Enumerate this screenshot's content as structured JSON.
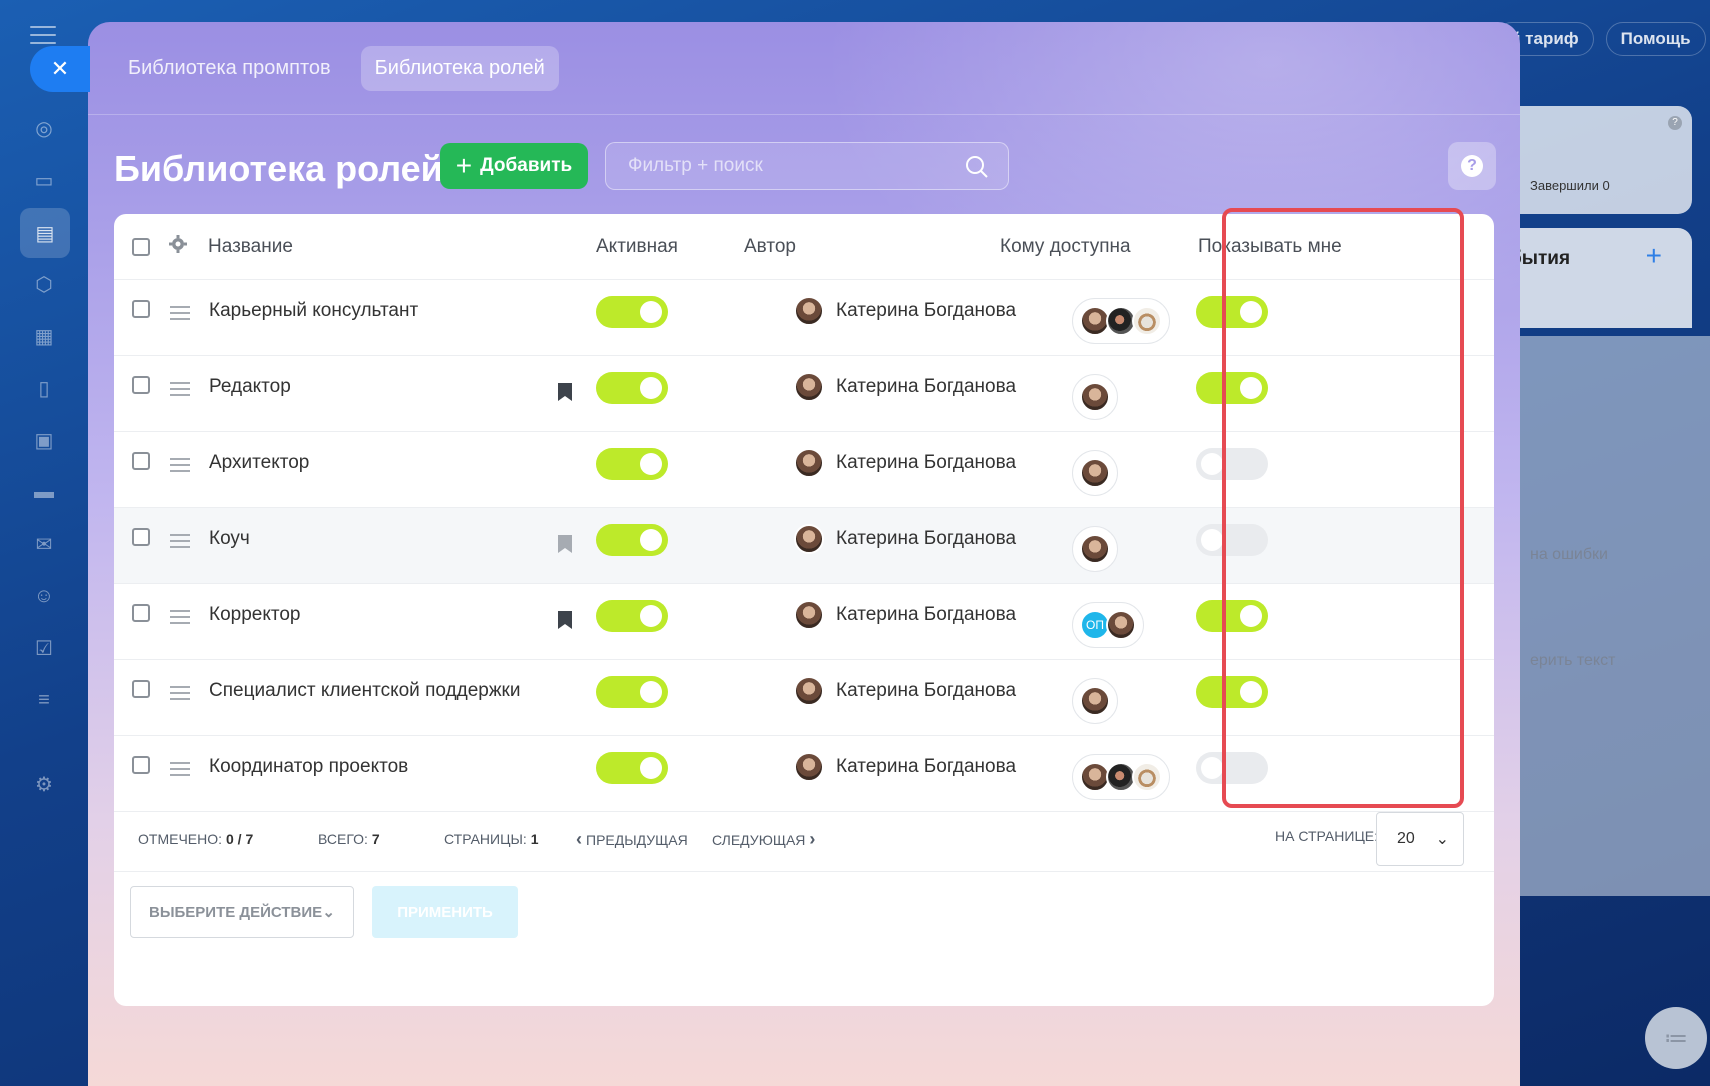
{
  "background": {
    "top_right": [
      "й тариф",
      "Помощь"
    ],
    "card_done": "Завершили 0",
    "card2_title": "бытия",
    "panel_line1": "на ошибки",
    "panel_line2": "ерить текст"
  },
  "tabs": [
    {
      "label": "Библиотека промптов",
      "active": false
    },
    {
      "label": "Библиотека ролей",
      "active": true
    }
  ],
  "page_title": "Библиотека ролей",
  "add_button": "Добавить",
  "search": {
    "placeholder": "Фильтр + поиск"
  },
  "help": "?",
  "columns": {
    "name": "Название",
    "active": "Активная",
    "author": "Автор",
    "access": "Кому доступна",
    "show_me": "Показывать мне"
  },
  "rows": [
    {
      "name": "Карьерный консультант",
      "bookmark": "none",
      "active": true,
      "author": "Катерина Богданова",
      "access": [
        "user",
        "user-dark",
        "cups"
      ],
      "show_me": true
    },
    {
      "name": "Редактор",
      "bookmark": "dark",
      "active": true,
      "author": "Катерина Богданова",
      "access": [
        "user"
      ],
      "show_me": true
    },
    {
      "name": "Архитектор",
      "bookmark": "none",
      "active": true,
      "author": "Катерина Богданова",
      "access": [
        "user"
      ],
      "show_me": false
    },
    {
      "name": "Коуч",
      "bookmark": "light",
      "active": true,
      "author": "Катерина Богданова",
      "access": [
        "user"
      ],
      "show_me": false
    },
    {
      "name": "Корректор",
      "bookmark": "dark",
      "active": true,
      "author": "Катерина Богданова",
      "access": [
        "ОП",
        "user"
      ],
      "show_me": true
    },
    {
      "name": "Специалист клиентской поддержки",
      "bookmark": "none",
      "active": true,
      "author": "Катерина Богданова",
      "access": [
        "user"
      ],
      "show_me": true
    },
    {
      "name": "Координатор проектов",
      "bookmark": "none",
      "active": true,
      "author": "Катерина Богданова",
      "access": [
        "user",
        "user-dark",
        "cups"
      ],
      "show_me": false
    }
  ],
  "footer": {
    "selected_label": "Отмечено:",
    "selected_value": "0 / 7",
    "total_label": "Всего:",
    "total_value": "7",
    "pages_label": "Страницы:",
    "pages_value": "1",
    "prev": "Предыдущая",
    "next": "Следующая",
    "per_page_label": "На странице:",
    "per_page_value": "20",
    "action_placeholder": "Выберите действие",
    "apply": "Применить"
  },
  "colors": {
    "toggle_on": "#bdea2a",
    "add_button": "#25b857",
    "highlight": "#e64a52"
  }
}
